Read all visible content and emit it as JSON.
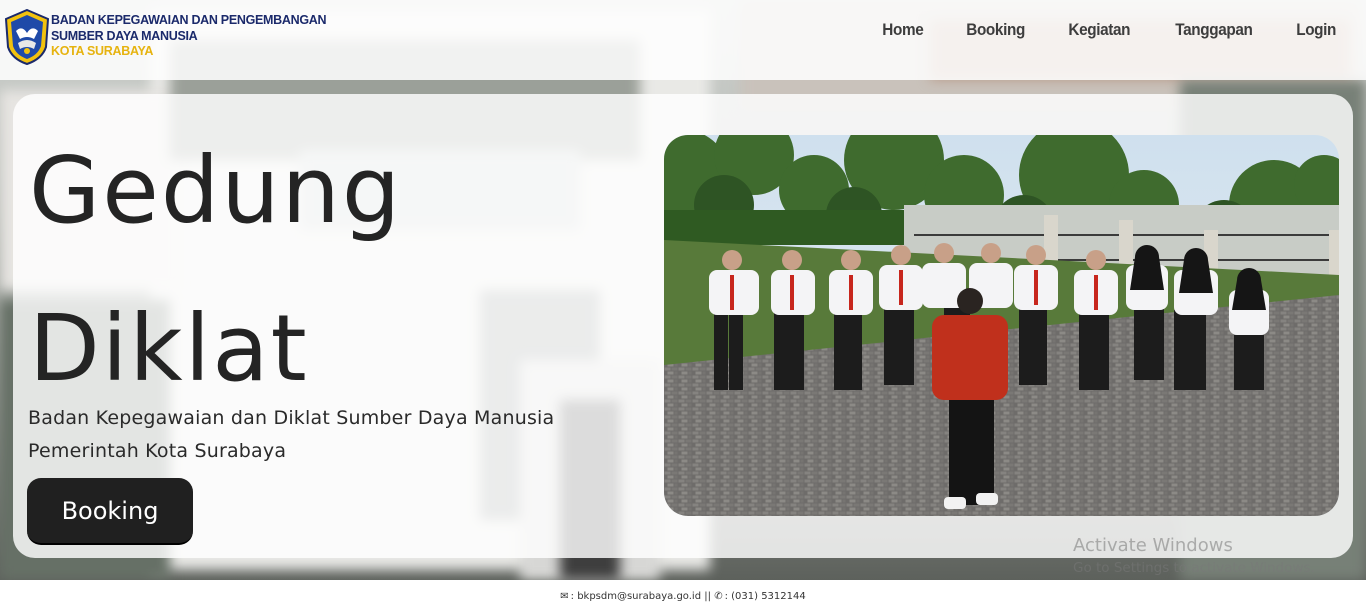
{
  "header": {
    "brand_line1": "BADAN KEPEGAWAIAN DAN PENGEMBANGAN",
    "brand_line2": "SUMBER DAYA MANUSIA",
    "brand_line3": "KOTA SURABAYA",
    "nav": [
      "Home",
      "Booking",
      "Kegiatan",
      "Tanggapan",
      "Login"
    ]
  },
  "hero": {
    "title_line1": "Gedung",
    "title_line2": "Diklat",
    "subtitle_line1": "Badan Kepegawaian dan Diklat Sumber Daya Manusia",
    "subtitle_line2": "Pemerintah Kota Surabaya",
    "button_label": "Booking"
  },
  "watermark": {
    "line1": "Activate Windows",
    "line2": "Go to Settings to activate Windows."
  },
  "footer": {
    "email_icon": "envelope-icon",
    "email": ": bkpsdm@surabaya.go.id",
    "separator": "||",
    "phone_icon": "phone-icon",
    "phone": ": (031) 5312144"
  },
  "colors": {
    "brand_blue": "#1b2a6b",
    "brand_gold": "#e6b30f",
    "button_bg": "#202020"
  }
}
